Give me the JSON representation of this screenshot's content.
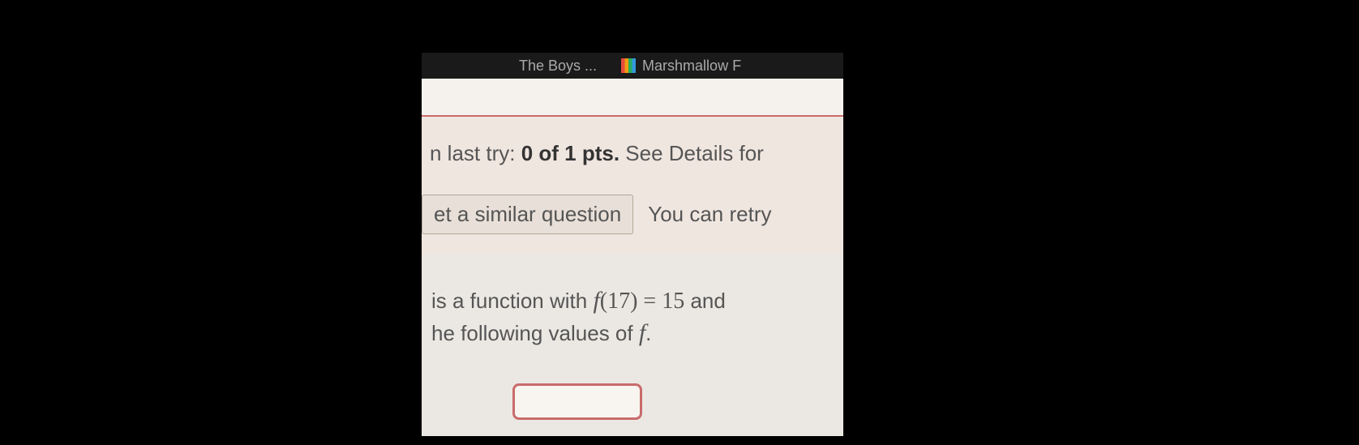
{
  "browser": {
    "bookmarks": [
      {
        "label": "The Boys ...",
        "icon": "generic"
      },
      {
        "label": "Marshmallow F",
        "icon": "rainbow"
      }
    ]
  },
  "score": {
    "prefix": "n last try: ",
    "points": "0 of 1 pts.",
    "suffix": " See Details for"
  },
  "retry": {
    "similar_button": "et a similar question",
    "retry_text": "You can retry"
  },
  "question": {
    "line1_prefix": " is a function with ",
    "function_expr": "f(17) = 15",
    "line1_suffix": " and",
    "line2_prefix": "he following values of ",
    "function_var": "f",
    "line2_suffix": "."
  }
}
